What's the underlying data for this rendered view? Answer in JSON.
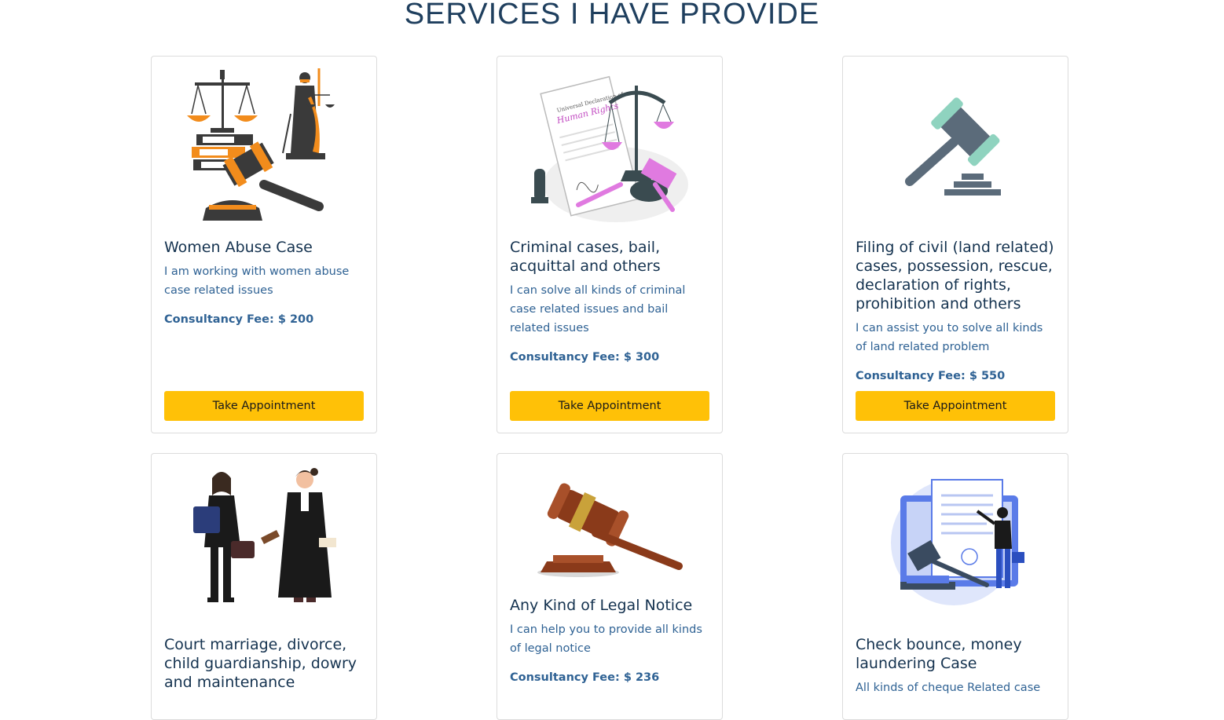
{
  "page": {
    "title": "SERVICES I HAVE PROVIDE"
  },
  "services": [
    {
      "title": "Women Abuse Case",
      "description": "I am working with women abuse case related issues",
      "fee": "Consultancy Fee: $ 200",
      "button": "Take Appointment",
      "icon": "scales-justice-icon"
    },
    {
      "title": "Criminal cases, bail, acquittal and others",
      "description": "I can solve all kinds of criminal case related issues and bail related issues",
      "fee": "Consultancy Fee: $ 300",
      "button": "Take Appointment",
      "icon": "human-rights-scales-icon",
      "image_text": [
        "Universal Declaration of",
        "Human Rights"
      ]
    },
    {
      "title": "Filing of civil (land related) cases, possession, rescue, declaration of rights, prohibition and others",
      "description": "I can assist you to solve all kinds of land related problem",
      "fee": "Consultancy Fee: $ 550",
      "button": "Take Appointment",
      "icon": "gavel-icon"
    },
    {
      "title": "Court marriage, divorce, child guardianship, dowry and maintenance",
      "icon": "lawyers-icon"
    },
    {
      "title": "Any Kind of Legal Notice",
      "description": "I can help you to provide all kinds of legal notice",
      "fee": "Consultancy Fee: $ 236",
      "icon": "wooden-gavel-icon"
    },
    {
      "title": "Check bounce, money laundering Case",
      "description": "All kinds of cheque Related case",
      "icon": "document-gavel-icon"
    }
  ],
  "colors": {
    "accent": "#ffc107",
    "title": "#14324f",
    "text": "#2f6294",
    "orange": "#f28c1c",
    "pink": "#e07ae0",
    "teal": "#8fd3bf",
    "blue": "#5a7be8"
  }
}
